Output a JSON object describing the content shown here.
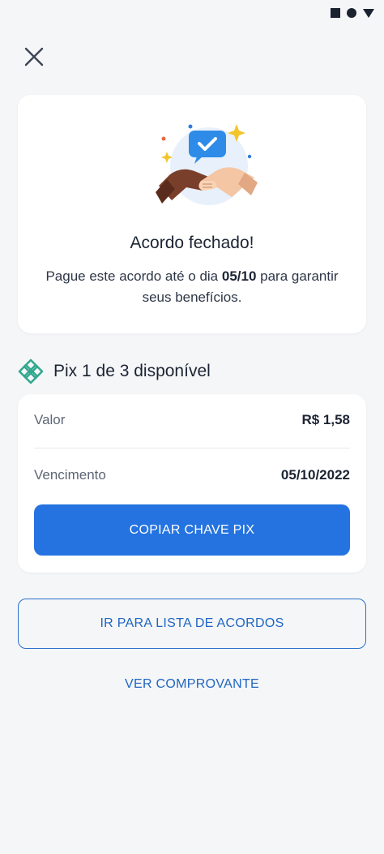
{
  "status_bar": {
    "icons": [
      "square-icon",
      "circle-icon",
      "triangle-icon"
    ]
  },
  "header": {
    "close_icon": "close-icon"
  },
  "confirmation": {
    "illustration": "handshake-illustration",
    "title": "Acordo fechado!",
    "desc_prefix": "Pague este acordo até o dia ",
    "due_date_short": "05/10",
    "desc_suffix": " para garantir seus benefícios."
  },
  "pix": {
    "icon": "pix-icon",
    "title": "Pix 1 de 3 disponível",
    "valor_label": "Valor",
    "valor_value": "R$ 1,58",
    "vencimento_label": "Vencimento",
    "vencimento_value": "05/10/2022",
    "copy_button": "COPIAR CHAVE PIX"
  },
  "actions": {
    "list_button": "IR PARA LISTA DE ACORDOS",
    "receipt_link": "VER COMPROVANTE"
  },
  "colors": {
    "primary": "#2473e0",
    "link": "#1f66c2",
    "pix_green": "#32a88f",
    "background": "#f5f6f8"
  }
}
